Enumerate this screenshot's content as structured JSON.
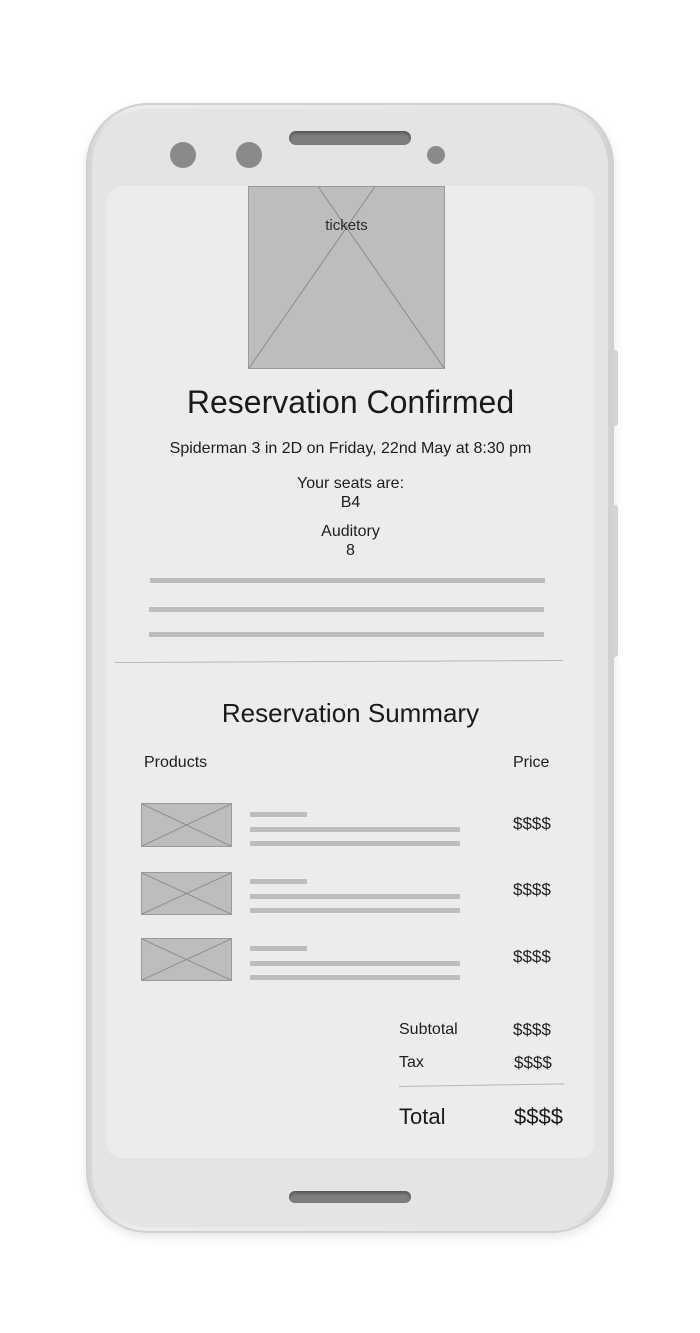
{
  "confirmation": {
    "image_label": "tickets",
    "title": "Reservation Confirmed",
    "movie_line": "Spiderman 3 in 2D on Friday, 22nd May at 8:30 pm",
    "seats_label": "Your seats are:",
    "seats_value": "B4",
    "auditory_label": "Auditory",
    "auditory_value": "8"
  },
  "summary": {
    "title": "Reservation Summary",
    "products_header": "Products",
    "price_header": "Price",
    "items": [
      {
        "price": "$$$$"
      },
      {
        "price": "$$$$"
      },
      {
        "price": "$$$$"
      }
    ],
    "subtotal_label": "Subtotal",
    "subtotal_value": "$$$$",
    "tax_label": "Tax",
    "tax_value": "$$$$",
    "total_label": "Total",
    "total_value": "$$$$"
  }
}
